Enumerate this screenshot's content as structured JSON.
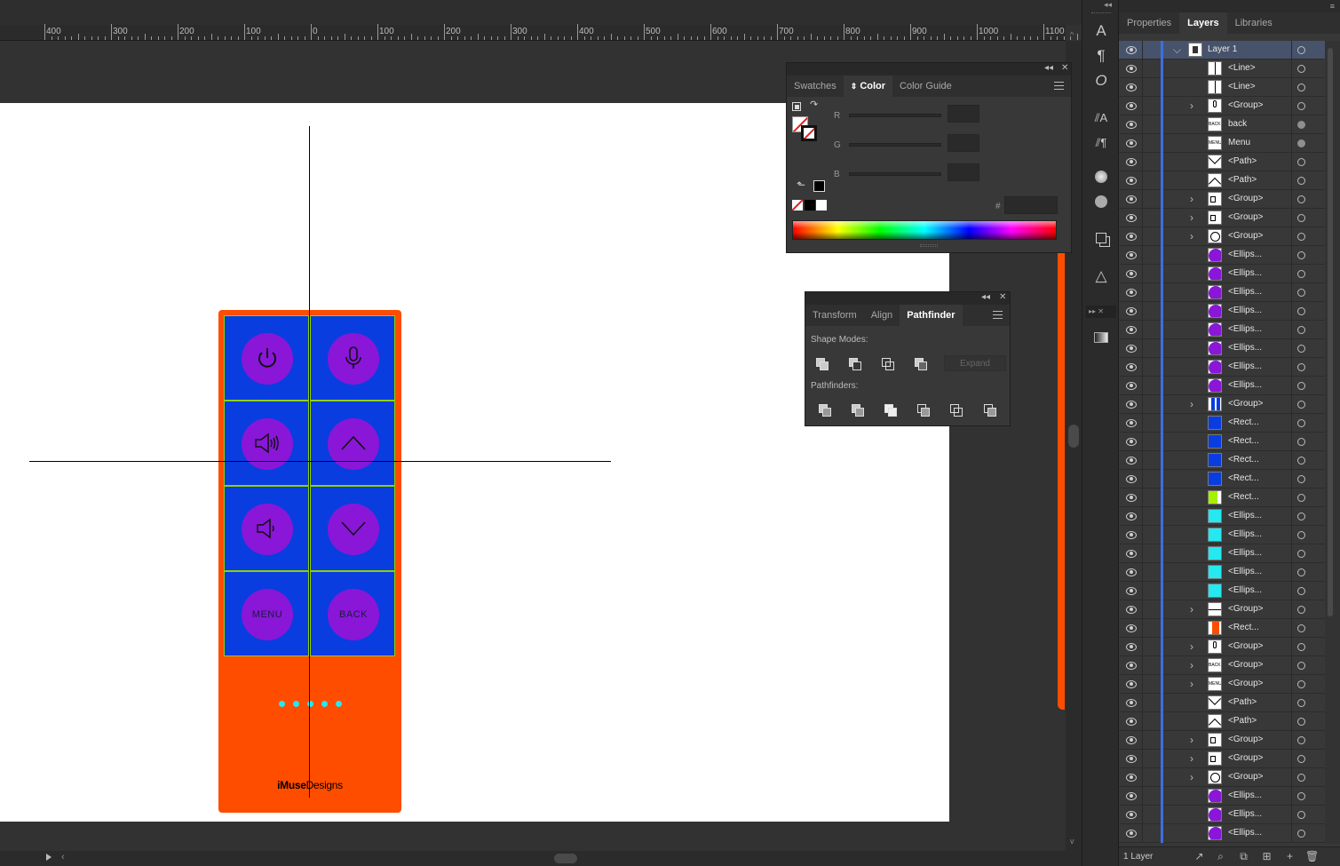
{
  "ruler": {
    "labels": [
      "400",
      "300",
      "200",
      "100",
      "0",
      "100",
      "200",
      "300",
      "400",
      "500",
      "600",
      "700",
      "800",
      "900",
      "1000",
      "1100"
    ]
  },
  "artboard": {
    "remote": {
      "buttons": [
        {
          "name": "power",
          "icon": "power-icon",
          "label": ""
        },
        {
          "name": "microphone",
          "icon": "microphone-icon",
          "label": ""
        },
        {
          "name": "volume-up",
          "icon": "volume-up-icon",
          "label": ""
        },
        {
          "name": "arrow-up",
          "icon": "chevron-up-icon",
          "label": ""
        },
        {
          "name": "volume-down",
          "icon": "volume-down-icon",
          "label": ""
        },
        {
          "name": "arrow-down",
          "icon": "chevron-down-icon",
          "label": ""
        },
        {
          "name": "menu",
          "icon": "",
          "label": "MENU"
        },
        {
          "name": "back",
          "icon": "",
          "label": "BACK"
        }
      ],
      "brand_bold": "iMuse",
      "brand_regular": "Designs",
      "colors": {
        "body": "#ff4d00",
        "button_bg": "#0a3de0",
        "circle": "#8a16d8",
        "dots": "#26e8f0"
      }
    }
  },
  "color_panel": {
    "tabs": [
      "Swatches",
      "Color",
      "Color Guide"
    ],
    "active_tab": "Color",
    "channels": [
      "R",
      "G",
      "B"
    ],
    "hex_label": "#"
  },
  "pathfinder_panel": {
    "tabs": [
      "Transform",
      "Align",
      "Pathfinder"
    ],
    "active_tab": "Pathfinder",
    "shape_modes_label": "Shape Modes:",
    "pathfinders_label": "Pathfinders:",
    "expand_label": "Expand"
  },
  "layers_panel": {
    "tabs": [
      "Properties",
      "Layers",
      "Libraries"
    ],
    "active_tab": "Layers",
    "footer_count": "1 Layer",
    "rows": [
      {
        "name": "Layer 1",
        "thumb": "layer",
        "expand": "open",
        "level": 0,
        "ring": "open"
      },
      {
        "name": "<Line>",
        "thumb": "line-v",
        "expand": "",
        "ring": "open"
      },
      {
        "name": "<Line>",
        "thumb": "line-v",
        "expand": "",
        "ring": "open"
      },
      {
        "name": "<Group>",
        "thumb": "mic",
        "expand": "closed",
        "ring": "open"
      },
      {
        "name": "back",
        "thumb": "text-back",
        "expand": "",
        "ring": "fill"
      },
      {
        "name": "Menu",
        "thumb": "text-menu",
        "expand": "",
        "ring": "fill"
      },
      {
        "name": "<Path>",
        "thumb": "chev-down",
        "expand": "",
        "ring": "open"
      },
      {
        "name": "<Path>",
        "thumb": "chev-up",
        "expand": "",
        "ring": "open"
      },
      {
        "name": "<Group>",
        "thumb": "speaker",
        "expand": "closed",
        "ring": "open"
      },
      {
        "name": "<Group>",
        "thumb": "speaker",
        "expand": "closed",
        "ring": "open"
      },
      {
        "name": "<Group>",
        "thumb": "power",
        "expand": "closed",
        "ring": "open"
      },
      {
        "name": "<Ellips...",
        "thumb": "purple",
        "expand": "",
        "ring": "open"
      },
      {
        "name": "<Ellips...",
        "thumb": "purple",
        "expand": "",
        "ring": "open"
      },
      {
        "name": "<Ellips...",
        "thumb": "purple",
        "expand": "",
        "ring": "open"
      },
      {
        "name": "<Ellips...",
        "thumb": "purple",
        "expand": "",
        "ring": "open"
      },
      {
        "name": "<Ellips...",
        "thumb": "purple",
        "expand": "",
        "ring": "open"
      },
      {
        "name": "<Ellips...",
        "thumb": "purple",
        "expand": "",
        "ring": "open"
      },
      {
        "name": "<Ellips...",
        "thumb": "purple",
        "expand": "",
        "ring": "open"
      },
      {
        "name": "<Ellips...",
        "thumb": "purple",
        "expand": "",
        "ring": "open"
      },
      {
        "name": "<Group>",
        "thumb": "blue-bar",
        "expand": "closed",
        "ring": "open"
      },
      {
        "name": "<Rect...",
        "thumb": "blue",
        "expand": "",
        "ring": "open"
      },
      {
        "name": "<Rect...",
        "thumb": "blue",
        "expand": "",
        "ring": "open"
      },
      {
        "name": "<Rect...",
        "thumb": "blue",
        "expand": "",
        "ring": "open"
      },
      {
        "name": "<Rect...",
        "thumb": "blue",
        "expand": "",
        "ring": "open"
      },
      {
        "name": "<Rect...",
        "thumb": "green",
        "expand": "",
        "ring": "open"
      },
      {
        "name": "<Ellips...",
        "thumb": "cyan",
        "expand": "",
        "ring": "open"
      },
      {
        "name": "<Ellips...",
        "thumb": "cyan",
        "expand": "",
        "ring": "open"
      },
      {
        "name": "<Ellips...",
        "thumb": "cyan",
        "expand": "",
        "ring": "open"
      },
      {
        "name": "<Ellips...",
        "thumb": "cyan",
        "expand": "",
        "ring": "open"
      },
      {
        "name": "<Ellips...",
        "thumb": "cyan",
        "expand": "",
        "ring": "open"
      },
      {
        "name": "<Group>",
        "thumb": "line-h",
        "expand": "closed",
        "ring": "open"
      },
      {
        "name": "<Rect...",
        "thumb": "orange",
        "expand": "",
        "ring": "open"
      },
      {
        "name": "<Group>",
        "thumb": "mic",
        "expand": "closed",
        "ring": "open"
      },
      {
        "name": "<Group>",
        "thumb": "text-back",
        "expand": "closed",
        "ring": "open"
      },
      {
        "name": "<Group>",
        "thumb": "text-menu",
        "expand": "closed",
        "ring": "open"
      },
      {
        "name": "<Path>",
        "thumb": "chev-down",
        "expand": "",
        "ring": "open"
      },
      {
        "name": "<Path>",
        "thumb": "chev-up",
        "expand": "",
        "ring": "open"
      },
      {
        "name": "<Group>",
        "thumb": "speaker",
        "expand": "closed",
        "ring": "open"
      },
      {
        "name": "<Group>",
        "thumb": "speaker",
        "expand": "closed",
        "ring": "open"
      },
      {
        "name": "<Group>",
        "thumb": "power",
        "expand": "closed",
        "ring": "open"
      },
      {
        "name": "<Ellips...",
        "thumb": "purple",
        "expand": "",
        "ring": "open"
      },
      {
        "name": "<Ellips...",
        "thumb": "purple",
        "expand": "",
        "ring": "open"
      },
      {
        "name": "<Ellips...",
        "thumb": "purple",
        "expand": "",
        "ring": "open"
      }
    ]
  }
}
